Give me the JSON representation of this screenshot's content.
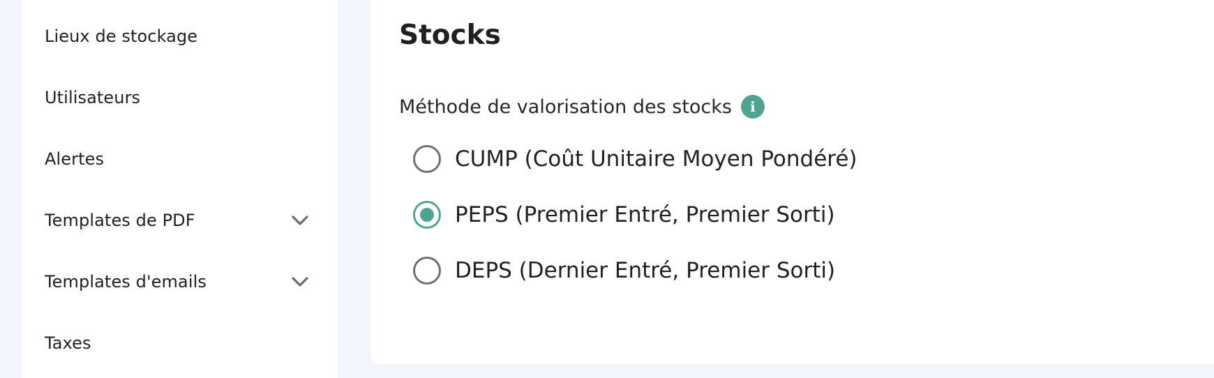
{
  "sidebar": {
    "items": [
      {
        "label": "Lieux de stockage",
        "expandable": false
      },
      {
        "label": "Utilisateurs",
        "expandable": false
      },
      {
        "label": "Alertes",
        "expandable": false
      },
      {
        "label": "Templates de PDF",
        "expandable": true,
        "icon": "chevron-down-icon"
      },
      {
        "label": "Templates d'emails",
        "expandable": true,
        "icon": "chevron-down-icon"
      },
      {
        "label": "Taxes",
        "expandable": false
      }
    ]
  },
  "main": {
    "title": "Stocks",
    "valuation": {
      "label": "Méthode de valorisation des stocks",
      "info_icon": "i",
      "options": [
        {
          "label": "CUMP (Coût Unitaire Moyen Pondéré)",
          "selected": false
        },
        {
          "label": "PEPS (Premier Entré, Premier Sorti)",
          "selected": true
        },
        {
          "label": "DEPS (Dernier Entré, Premier Sorti)",
          "selected": false
        }
      ]
    }
  },
  "colors": {
    "accent": "#4fa491",
    "background": "#f4f6fd",
    "panel": "#ffffff",
    "text": "#1f1f24",
    "radio_border": "#6f6f74"
  }
}
